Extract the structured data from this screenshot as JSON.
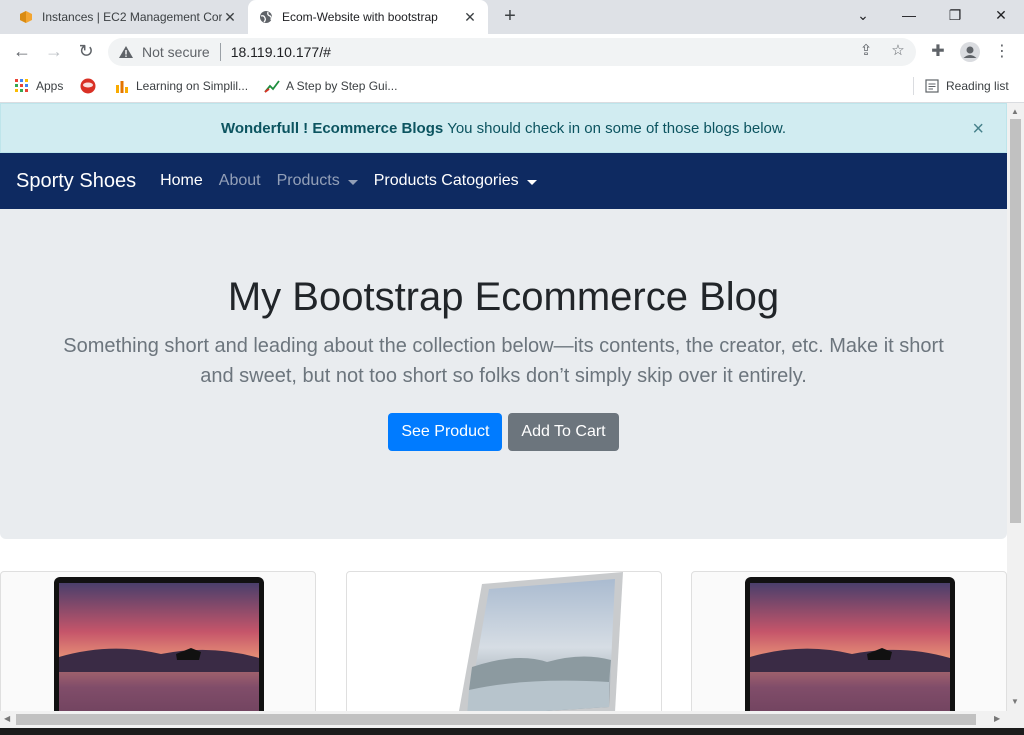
{
  "browser": {
    "tabs": [
      {
        "title": "Instances | EC2 Management Cor",
        "active": false
      },
      {
        "title": "Ecom-Website with bootstrap",
        "active": true
      }
    ],
    "address": {
      "security": "Not secure",
      "url": "18.119.10.177/#"
    },
    "bookmarks": [
      {
        "label": "Apps"
      },
      {
        "label": ""
      },
      {
        "label": "Learning on Simplil..."
      },
      {
        "label": "A Step by Step Gui..."
      }
    ],
    "reading_list": "Reading list"
  },
  "alert": {
    "strong": "Wonderfull ! Ecommerce Blogs",
    "text": "You should check in on some of those blogs below.",
    "close": "×"
  },
  "navbar": {
    "brand": "Sporty Shoes",
    "links": [
      {
        "label": "Home"
      },
      {
        "label": "About"
      },
      {
        "label": "Products"
      },
      {
        "label": "Products Catogories"
      }
    ]
  },
  "jumbotron": {
    "title": "My Bootstrap Ecommerce Blog",
    "lead": "Something short and leading about the collection below—its contents, the creator, etc. Make it short and sweet, but not too short so folks don’t simply skip over it entirely.",
    "primary_button": "See Product",
    "secondary_button": "Add To Cart"
  },
  "colors": {
    "navbar": "#0e2a61",
    "alert_bg": "#d1ecf1",
    "primary": "#007bff",
    "secondary": "#6c757d"
  }
}
